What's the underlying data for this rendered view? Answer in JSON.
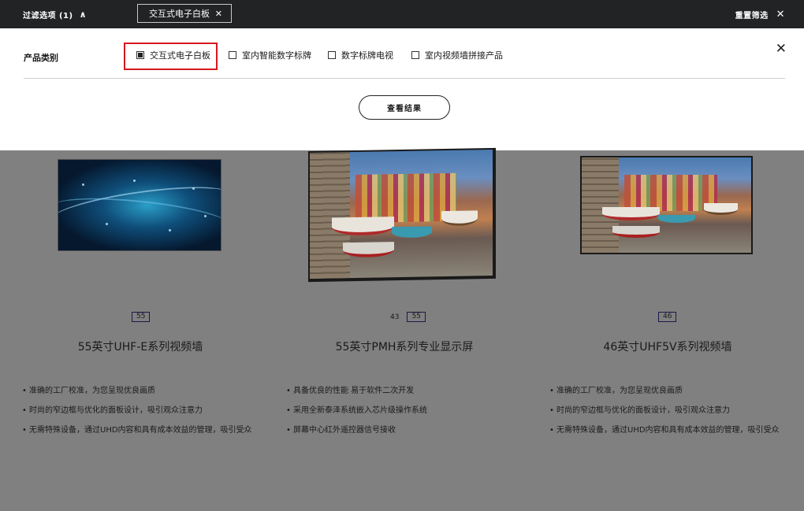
{
  "filter_bar": {
    "toggle_label": "过滤选项 (1)",
    "active_chip": "交互式电子白板",
    "reset_label": "重置筛选"
  },
  "filter_panel": {
    "category_label": "产品类别",
    "options": [
      {
        "label": "交互式电子白板",
        "checked": true
      },
      {
        "label": "室内智能数字标牌",
        "checked": false
      },
      {
        "label": "数字标牌电视",
        "checked": false
      },
      {
        "label": "室内视频墙拼接产品",
        "checked": false
      }
    ],
    "results_button": "查看结果"
  },
  "products": [
    {
      "sizes": [
        "55"
      ],
      "title": "55英寸UHF-E系列视频墙",
      "features": [
        "准确的工厂校准，为您呈现优良画质",
        "时尚的窄边框与优化的面板设计，吸引观众注意力",
        "无需特殊设备，通过UHD内容和具有成本效益的管理，吸引受众"
      ]
    },
    {
      "sizes": [
        "43",
        "55"
      ],
      "title": "55英寸PMH系列专业显示屏",
      "features": [
        "具备优良的性能 易于软件二次开发",
        "采用全新泰泽系统嵌入芯片级操作系统",
        "屏幕中心红外遥控器信号接收"
      ]
    },
    {
      "sizes": [
        "46"
      ],
      "title": "46英寸UHF5V系列视频墙",
      "features": [
        "准确的工厂校准，为您呈现优良画质",
        "时尚的窄边框与优化的面板设计，吸引观众注意力",
        "无需特殊设备，通过UHD内容和具有成本效益的管理，吸引受众"
      ]
    }
  ],
  "colors": {
    "topbar_bg": "#222325",
    "overlay": "#808080",
    "highlight_border": "#d5181e"
  }
}
